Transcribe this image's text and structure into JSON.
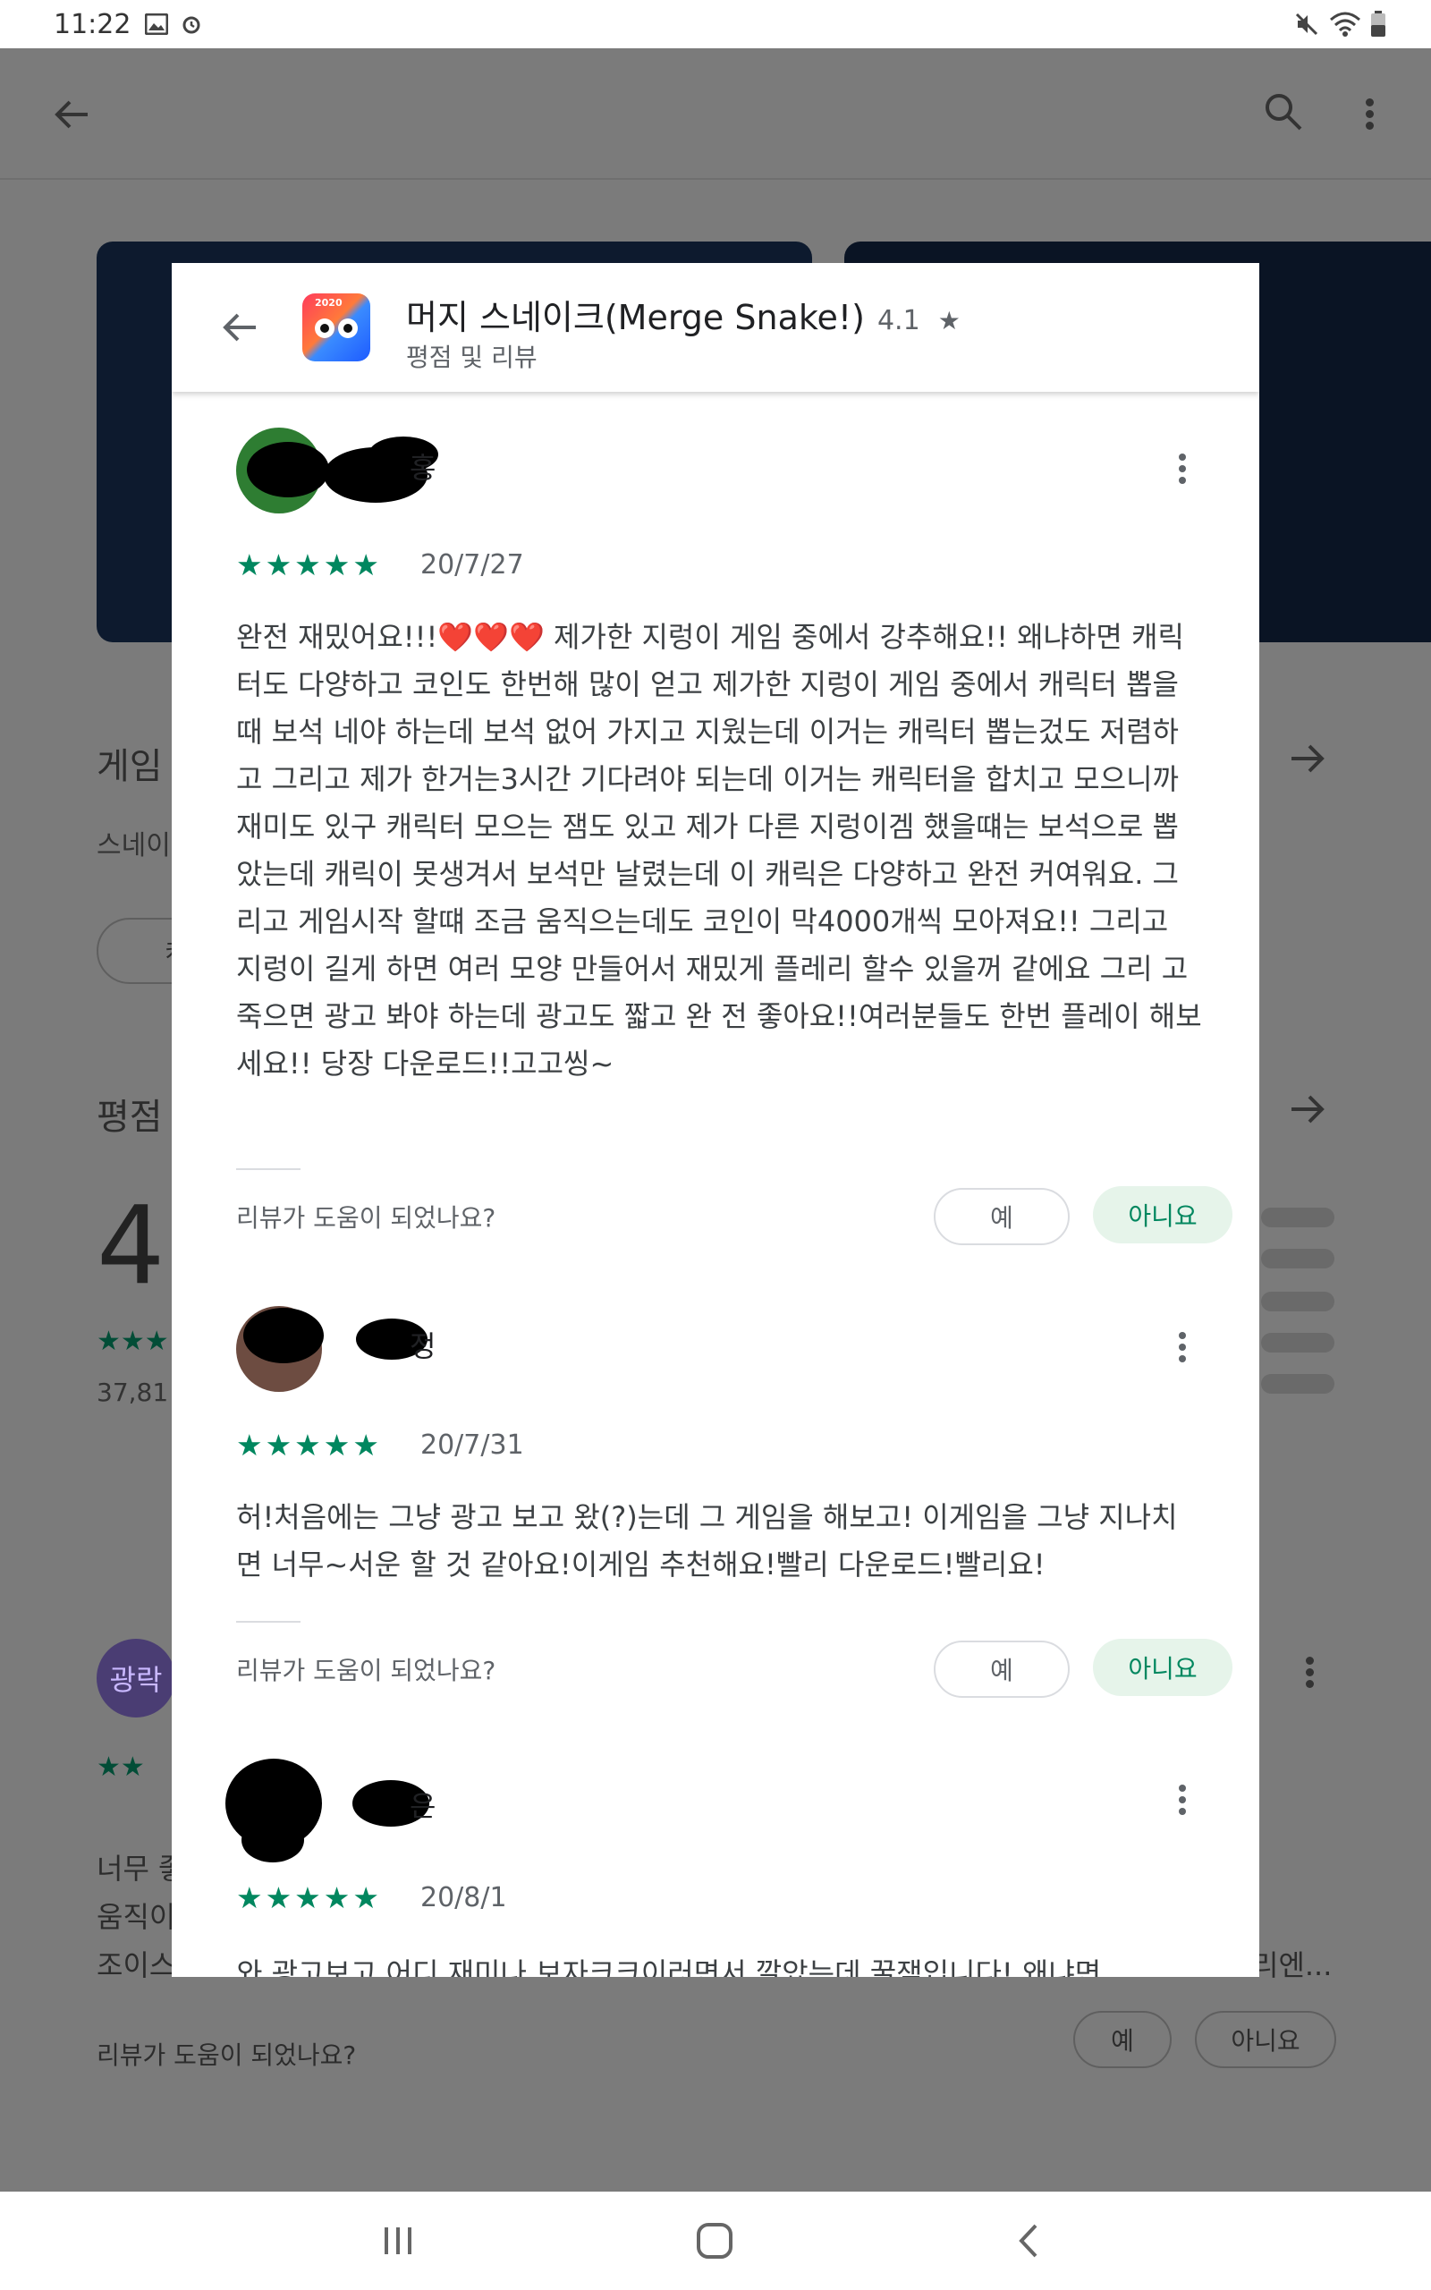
{
  "status_bar": {
    "time": "11:22"
  },
  "background": {
    "section1_title": "게임",
    "section1_sub": "스네이",
    "section1_chip": "캐릭",
    "section2_title": "평점",
    "big_rating": "4",
    "rating_count": "37,81",
    "review3_initial": "광락",
    "review3_text_line1": "너무 좋",
    "review3_text_line2": "움직이",
    "review3_text_line3": "조이스",
    "review3_text_tail": "리엔...",
    "helpful_question": "리뷰가 도움이 되었나요?",
    "yes_label": "예",
    "no_label": "아니요"
  },
  "dialog": {
    "app_title": "머지 스네이크(Merge Snake!)",
    "app_rating": "4.1",
    "star_glyph": "★",
    "subtitle": "평점 및 리뷰",
    "icon_badge": "2020",
    "reviews": [
      {
        "name_visible": "홍",
        "stars": "★★★★★",
        "date": "20/7/27",
        "text": "완전 재밌어요!!!❤️❤️❤️ 제가한 지렁이 게임 중에서 강추해요!! 왜냐하면 캐릭터도 다양하고 코인도 한번해 많이 얻고 제가한 지렁이 게임 중에서 캐릭터 뽑을 때 보석 네야 하는데 보석 없어 가지고 지웠는데 이거는 캐릭터 뽑는겄도 저렴하고 그리고 제가 한거는3시간 기다려야 되는데 이거는 캐릭터을 합치고 모으니까 재미도 있구 캐릭터 모으는 잼도 있고 제가 다른 지렁이겜 했을떄는 보석으로 뽑았는데 캐릭이 못생겨서 보석만 날렸는데 이 캐릭은 다양하고 완전 커여워요. 그리고 게임시작 할떄 조금 움직으는데도 코인이 막4000개씩 모아져요!! 그리고 지렁이 길게 하면 여러 모양 만들어서 재밌게 플레리 할수 있을꺼 같에요 그리 고 죽으면 광고 봐야 하는데 광고도 짧고 완 전 좋아요!!여러분들도 한번 플레이 해보세요!! 당장 다운로드!!고고씽~",
        "helpful_question": "리뷰가 도움이 되었나요?",
        "yes_label": "예",
        "no_label": "아니요"
      },
      {
        "name_visible": "정",
        "stars": "★★★★★",
        "date": "20/7/31",
        "text": "허!처음에는 그냥 광고 보고 왔(?)는데 그 게임을 해보고! 이게임을 그냥 지나치면 너무~서운 할 것 같아요!이게임 추천해요!빨리 다운로드!빨리요!",
        "helpful_question": "리뷰가 도움이 되었나요?",
        "yes_label": "예",
        "no_label": "아니요"
      },
      {
        "name_visible": "은",
        "stars": "★★★★★",
        "date": "20/8/1",
        "text": "와 광고보고 어디 재미나 보자크크이러면서 깔았는데 꿀잼입니다! 왜냐면"
      }
    ]
  },
  "colors": {
    "accent_green": "#01875f",
    "overlay_gray": "#7b7b7b",
    "text_primary": "#202124"
  }
}
